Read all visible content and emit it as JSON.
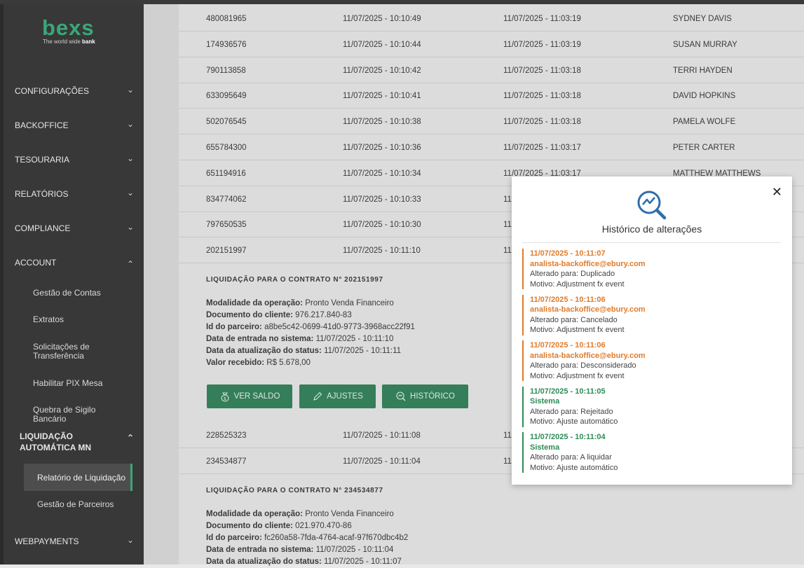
{
  "sidebar": {
    "logo_word": "bexs",
    "logo_tagline_pre": "The world wide ",
    "logo_tagline_bold": "bank",
    "items": [
      {
        "label": "CONFIGURAÇÕES",
        "icon": "chevron-down-icon"
      },
      {
        "label": "BACKOFFICE",
        "icon": "chevron-down-icon"
      },
      {
        "label": "TESOURARIA",
        "icon": "chevron-down-icon"
      },
      {
        "label": "RELATÓRIOS",
        "icon": "chevron-down-icon"
      },
      {
        "label": "COMPLIANCE",
        "icon": "chevron-down-icon"
      },
      {
        "label": "ACCOUNT",
        "icon": "chevron-up-icon"
      }
    ],
    "account_sub": [
      "Gestão de Contas",
      "Extratos",
      "Solicitações de Transferência",
      "Habilitar PIX Mesa",
      "Quebra de Sigilo Bancário"
    ],
    "liquidacao_label": "LIQUIDAÇÃO AUTOMÁTICA MN",
    "liquidacao_sub": [
      "Relatório de Liquidação",
      "Gestão de Parceiros"
    ],
    "webpayments_label": "WEBPAYMENTS",
    "accent": "#3aa77a"
  },
  "table": {
    "rows_top": [
      {
        "id": "480081965",
        "entry": "11/07/2025 - 10:10:49",
        "update": "11/07/2025 - 11:03:19",
        "name": "SYDNEY DAVIS"
      },
      {
        "id": "174936576",
        "entry": "11/07/2025 - 10:10:44",
        "update": "11/07/2025 - 11:03:19",
        "name": "SUSAN MURRAY"
      },
      {
        "id": "790113858",
        "entry": "11/07/2025 - 10:10:42",
        "update": "11/07/2025 - 11:03:18",
        "name": "TERRI HAYDEN"
      },
      {
        "id": "633095649",
        "entry": "11/07/2025 - 10:10:41",
        "update": "11/07/2025 - 11:03:18",
        "name": "DAVID HOPKINS"
      },
      {
        "id": "502076545",
        "entry": "11/07/2025 - 10:10:38",
        "update": "11/07/2025 - 11:03:18",
        "name": "PAMELA WOLFE"
      },
      {
        "id": "655784300",
        "entry": "11/07/2025 - 10:10:36",
        "update": "11/07/2025 - 11:03:17",
        "name": "PETER CARTER"
      },
      {
        "id": "651194916",
        "entry": "11/07/2025 - 10:10:34",
        "update": "11/07/2025 - 11:03:17",
        "name": "MATTHEW MATTHEWS"
      },
      {
        "id": "834774062",
        "entry": "11/07/2025 - 10:10:33",
        "update": "11",
        "name": ""
      },
      {
        "id": "797650535",
        "entry": "11/07/2025 - 10:10:30",
        "update": "11",
        "name": ""
      },
      {
        "id": "202151997",
        "entry": "11/07/2025 - 10:11:10",
        "update": "11",
        "name": ""
      }
    ],
    "rows_mid": [
      {
        "id": "228525323",
        "entry": "11/07/2025 - 10:11:08",
        "update": "11",
        "name": ""
      },
      {
        "id": "234534877",
        "entry": "11/07/2025 - 10:11:04",
        "update": "11",
        "name": ""
      }
    ]
  },
  "detail1": {
    "header": "LIQUIDAÇÃO PARA O CONTRATO N° 202151997",
    "lines": [
      {
        "k": "Modalidade da operação:",
        "v": " Pronto Venda Financeiro"
      },
      {
        "k": "Documento do cliente:",
        "v": " 976.217.840-83"
      },
      {
        "k": "Id do parceiro:",
        "v": " a8be5c42-0699-41d0-9773-3968acc22f91"
      },
      {
        "k": "Data de entrada no sistema:",
        "v": " 11/07/2025 - 10:11:10"
      },
      {
        "k": "Data da atualização do status:",
        "v": " 11/07/2025 - 10:11:11"
      },
      {
        "k": "Valor recebido:",
        "v": " R$ 5.678,00"
      }
    ],
    "buttons": {
      "saldo": "VER SALDO",
      "ajustes": "AJUSTES",
      "historico": "HISTÓRICO"
    }
  },
  "detail2": {
    "header": "LIQUIDAÇÃO PARA O CONTRATO N° 234534877",
    "lines": [
      {
        "k": "Modalidade da operação:",
        "v": " Pronto Venda Financeiro"
      },
      {
        "k": "Documento do cliente:",
        "v": " 021.970.470-86"
      },
      {
        "k": "Id do parceiro:",
        "v": " fc260a58-7fda-4764-acaf-97f670dbc4b2"
      },
      {
        "k": "Data de entrada no sistema:",
        "v": " 11/07/2025 - 10:11:04"
      },
      {
        "k": "Data da atualização do status:",
        "v": " 11/07/2025 - 10:11:07"
      }
    ]
  },
  "modal": {
    "title": "Histórico de alterações",
    "close": "✕",
    "entries": [
      {
        "date": "11/07/2025 - 10:11:07",
        "who": "analista-backoffice@ebury.com",
        "to": "Alterado para: Duplicado",
        "reason": "Motivo: Adjustment fx event",
        "color": "orange"
      },
      {
        "date": "11/07/2025 - 10:11:06",
        "who": "analista-backoffice@ebury.com",
        "to": "Alterado para: Cancelado",
        "reason": "Motivo: Adjustment fx event",
        "color": "orange"
      },
      {
        "date": "11/07/2025 - 10:11:06",
        "who": "analista-backoffice@ebury.com",
        "to": "Alterado para: Desconsiderado",
        "reason": "Motivo: Adjustment fx event",
        "color": "orange"
      },
      {
        "date": "11/07/2025 - 10:11:05",
        "who": "Sistema",
        "to": "Alterado para: Rejeitado",
        "reason": "Motivo: Ajuste automático",
        "color": "green"
      },
      {
        "date": "11/07/2025 - 10:11:04",
        "who": "Sistema",
        "to": "Alterado para: A liquidar",
        "reason": "Motivo: Ajuste automático",
        "color": "green"
      }
    ]
  }
}
